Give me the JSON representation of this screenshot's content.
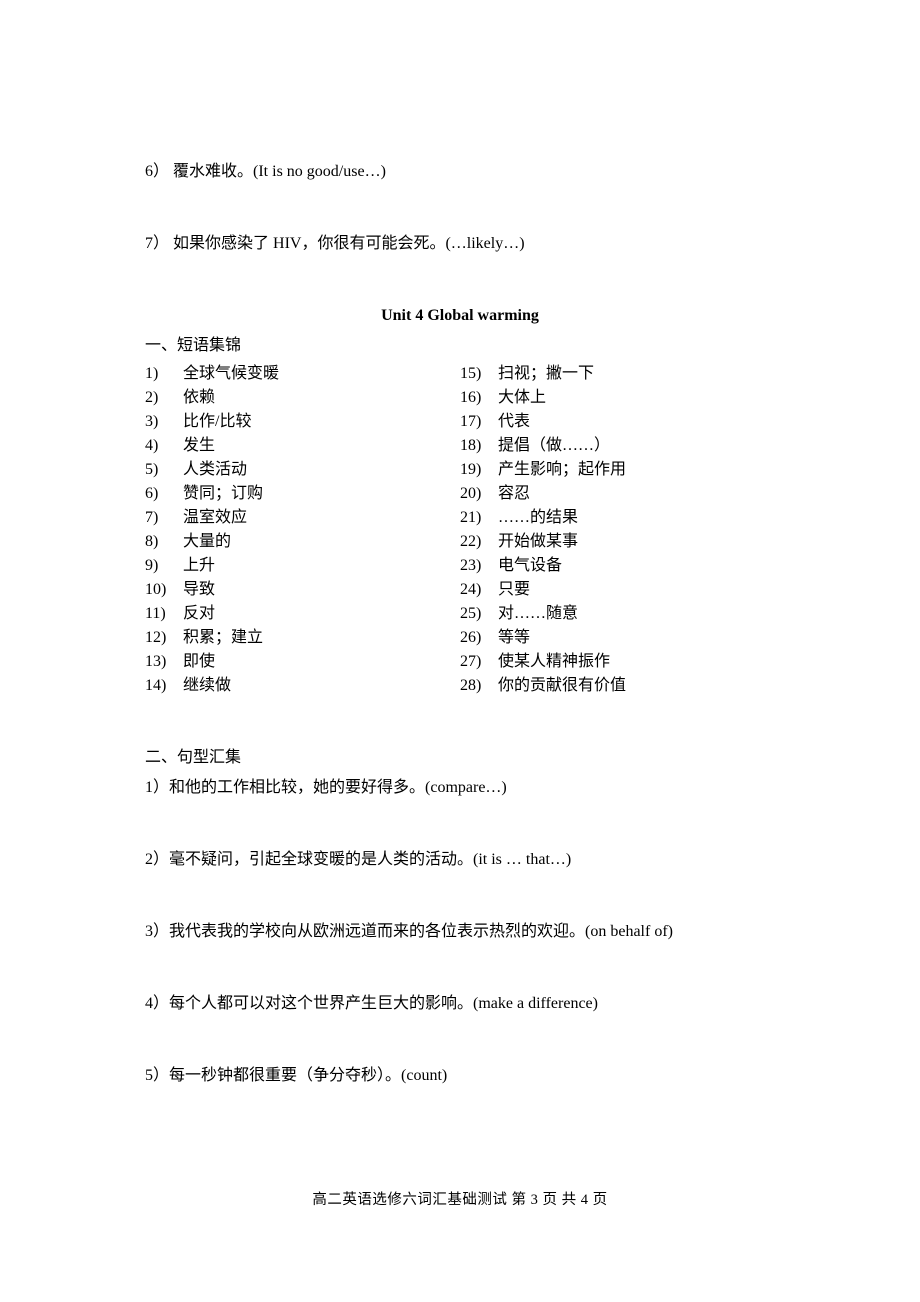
{
  "top_questions": [
    {
      "num": "6）",
      "text": "覆水难收。(It is no good/use…)"
    },
    {
      "num": "7）",
      "text": "如果你感染了 HIV，你很有可能会死。(…likely…)"
    }
  ],
  "unit_title": "Unit 4 Global warming",
  "section1_heading": "一、短语集锦",
  "phrases_left": [
    {
      "num": "1)",
      "text": "全球气候变暖"
    },
    {
      "num": "2)",
      "text": "依赖"
    },
    {
      "num": "3)",
      "text": "比作/比较"
    },
    {
      "num": "4)",
      "text": "发生"
    },
    {
      "num": "5)",
      "text": "人类活动"
    },
    {
      "num": "6)",
      "text": "赞同；订购"
    },
    {
      "num": "7)",
      "text": "温室效应"
    },
    {
      "num": "8)",
      "text": "大量的"
    },
    {
      "num": "9)",
      "text": "上升"
    },
    {
      "num": "10)",
      "text": "导致"
    },
    {
      "num": "11)",
      "text": "反对"
    },
    {
      "num": "12)",
      "text": "积累；建立"
    },
    {
      "num": "13)",
      "text": "即使"
    },
    {
      "num": "14)",
      "text": "继续做"
    }
  ],
  "phrases_right": [
    {
      "num": "15)",
      "text": "扫视；撇一下"
    },
    {
      "num": "16)",
      "text": "大体上"
    },
    {
      "num": "17)",
      "text": "代表"
    },
    {
      "num": "18)",
      "text": "提倡（做……）"
    },
    {
      "num": "19)",
      "text": "产生影响；起作用"
    },
    {
      "num": "20)",
      "text": "容忍"
    },
    {
      "num": "21)",
      "text": "……的结果"
    },
    {
      "num": "22)",
      "text": "开始做某事"
    },
    {
      "num": "23)",
      "text": "电气设备"
    },
    {
      "num": "24)",
      "text": "只要"
    },
    {
      "num": "25)",
      "text": "对……随意"
    },
    {
      "num": "26)",
      "text": "等等"
    },
    {
      "num": "27)",
      "text": "使某人精神振作"
    },
    {
      "num": "28)",
      "text": "你的贡献很有价值"
    }
  ],
  "section2_heading": "二、句型汇集",
  "sentences": [
    {
      "num": "1）",
      "text": "和他的工作相比较，她的要好得多。(compare…)"
    },
    {
      "num": "2）",
      "text": "毫不疑问，引起全球变暖的是人类的活动。(it is … that…)"
    },
    {
      "num": "3）",
      "text": "我代表我的学校向从欧洲远道而来的各位表示热烈的欢迎。(on behalf of)"
    },
    {
      "num": "4）",
      "text": "每个人都可以对这个世界产生巨大的影响。(make a difference)"
    },
    {
      "num": "5）",
      "text": "每一秒钟都很重要（争分夺秒）。(count)"
    }
  ],
  "footer": "高二英语选修六词汇基础测试  第 3 页 共 4 页"
}
